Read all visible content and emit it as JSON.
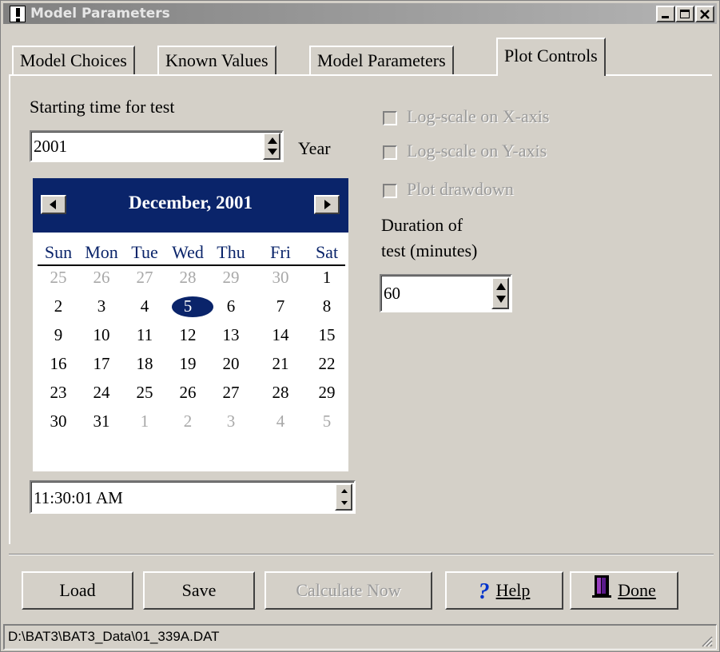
{
  "window": {
    "title": "Model Parameters",
    "icon": "exclamation-icon"
  },
  "tabs": [
    {
      "label": "Model Choices"
    },
    {
      "label": "Known Values"
    },
    {
      "label": "Model Parameters"
    },
    {
      "label": "Plot Controls",
      "active": true
    }
  ],
  "start": {
    "label": "Starting time for test",
    "year_value": "2001",
    "year_label": "Year",
    "time_value": "11:30:01 AM"
  },
  "calendar": {
    "month_title": "December, 2001",
    "weekdays": [
      "Sun",
      "Mon",
      "Tue",
      "Wed",
      "Thu",
      "Fri",
      "Sat"
    ],
    "weeks": [
      [
        "25",
        "26",
        "27",
        "28",
        "29",
        "30",
        "1"
      ],
      [
        "2",
        "3",
        "4",
        "5",
        "6",
        "7",
        "8"
      ],
      [
        "9",
        "10",
        "11",
        "12",
        "13",
        "14",
        "15"
      ],
      [
        "16",
        "17",
        "18",
        "19",
        "20",
        "21",
        "22"
      ],
      [
        "23",
        "24",
        "25",
        "26",
        "27",
        "28",
        "29"
      ],
      [
        "30",
        "31",
        "1",
        "2",
        "3",
        "4",
        "5"
      ]
    ],
    "selected_day": "5",
    "colors": {
      "header": "#0a246a",
      "other_month": "#a8a8a8"
    }
  },
  "options": {
    "log_x": {
      "label": "Log-scale on X-axis",
      "checked": false,
      "enabled": false
    },
    "log_y": {
      "label": "Log-scale on Y-axis",
      "checked": false,
      "enabled": false
    },
    "plot_drawdown": {
      "label": "Plot drawdown",
      "checked": false,
      "enabled": false
    }
  },
  "duration": {
    "label_line1": "Duration of",
    "label_line2": "test (minutes)",
    "value": "60"
  },
  "buttons": {
    "load": "Load",
    "save": "Save",
    "calculate": "Calculate Now",
    "help": "Help",
    "done": "Done"
  },
  "status": {
    "path": "D:\\BAT3\\BAT3_Data\\01_339A.DAT"
  }
}
